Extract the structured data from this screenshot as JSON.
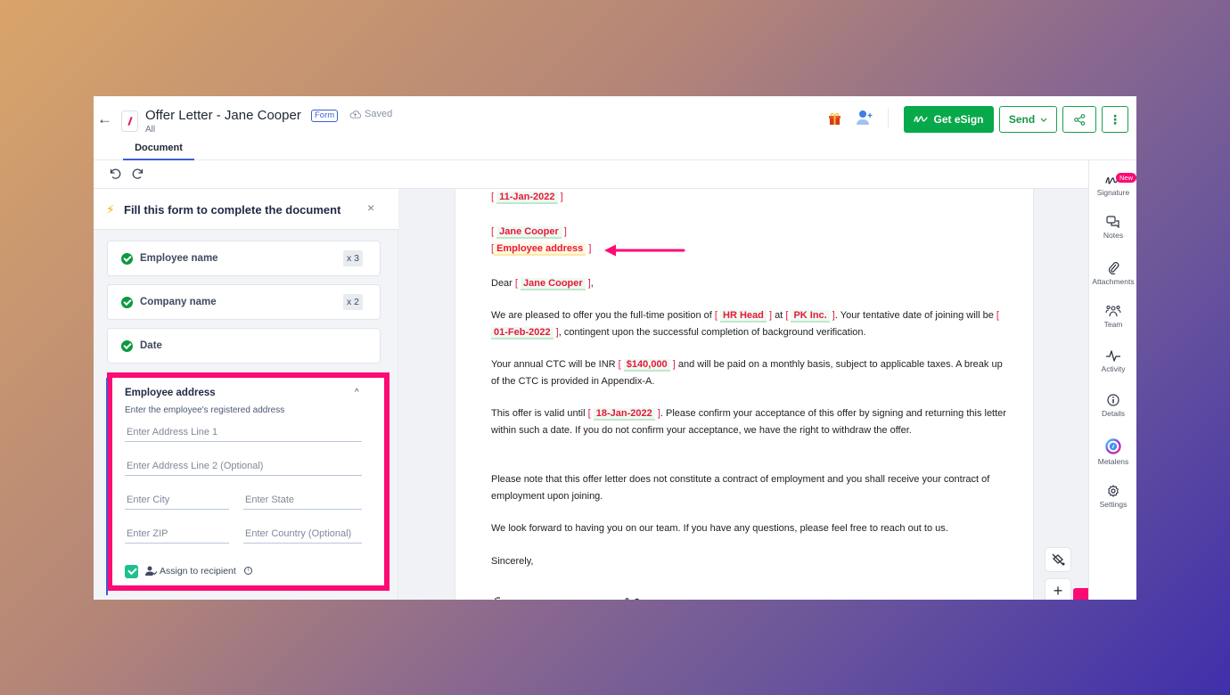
{
  "header": {
    "back_label": "←",
    "title": "Offer Letter - Jane Cooper",
    "badge": "Form",
    "save_status": "Saved",
    "subtitle": "All",
    "tabs": [
      {
        "label": "Document",
        "active": true
      }
    ],
    "esign_label": "Get eSign",
    "send_label": "Send",
    "more_label": "⋮",
    "icons": [
      "gift-icon",
      "add-user-icon",
      "share-icon"
    ]
  },
  "toolbar": {
    "undo": "undo-icon",
    "redo": "redo-icon"
  },
  "form_panel": {
    "title": "Fill this form to complete the document",
    "close": "×",
    "fields": [
      {
        "label": "Employee name",
        "count": "x 3",
        "completed": true
      },
      {
        "label": "Company name",
        "count": "x 2",
        "completed": true
      },
      {
        "label": "Date",
        "count": "",
        "completed": true
      }
    ],
    "address": {
      "title": "Employee address",
      "description": "Enter the employee's registered address",
      "collapse": "^",
      "placeholders": {
        "line1": "Enter Address Line 1",
        "line2": "Enter Address Line 2 (Optional)",
        "city": "Enter City",
        "state": "Enter State",
        "zip": "Enter ZIP",
        "country": "Enter Country (Optional)"
      },
      "assign_label": "Assign to recipient",
      "assign_checked": true,
      "info": "i"
    }
  },
  "document": {
    "date": "11-Jan-2022",
    "employee_name": "Jane Cooper",
    "employee_address": "Employee address",
    "dear": "Dear",
    "p1_a": "We are pleased to offer you the full-time position of",
    "position": "HR Head",
    "p1_b": "at",
    "company": "PK Inc.",
    "p1_c": ". Your tentative date of joining will be",
    "joining_date": "01-Feb-2022",
    "p1_d": ", contingent upon the successful completion of background verification.",
    "p2_a": "Your annual CTC will be INR",
    "ctc": "$140,000",
    "p2_b": "and will be paid on a monthly basis, subject to applicable taxes. A break up of the CTC is provided in Appendix-A.",
    "p3_a": "This offer is valid until",
    "valid_until": "18-Jan-2022",
    "p3_b": ". Please confirm your acceptance of this offer by signing and returning this letter within such a date. If you do not confirm your acceptance, we have the right to withdraw the offer.",
    "p4": "Please note that this offer letter does not constitute a contract of employment and you shall receive your contract of employment upon joining.",
    "p5": "We look forward to having you on our team. If you have any questions, please feel free to reach out to us.",
    "closing": "Sincerely,"
  },
  "float_buttons": {
    "fill": "paint-bucket-icon",
    "add": "+"
  },
  "right_sidebar": {
    "items": [
      {
        "label": "Signature",
        "icon": "signature-icon",
        "badge": "New"
      },
      {
        "label": "Notes",
        "icon": "notes-icon"
      },
      {
        "label": "Attachments",
        "icon": "paperclip-icon"
      },
      {
        "label": "Team",
        "icon": "team-icon"
      },
      {
        "label": "Activity",
        "icon": "activity-icon"
      },
      {
        "label": "Details",
        "icon": "info-icon"
      },
      {
        "label": "Metalens",
        "icon": "metalens-icon"
      },
      {
        "label": "Settings",
        "icon": "gear-icon"
      }
    ]
  },
  "colors": {
    "accent_blue": "#3d5fd1",
    "esign_green": "#07a94a",
    "highlight_pink": "#fd0a74",
    "variable_red": "#e8173b"
  }
}
